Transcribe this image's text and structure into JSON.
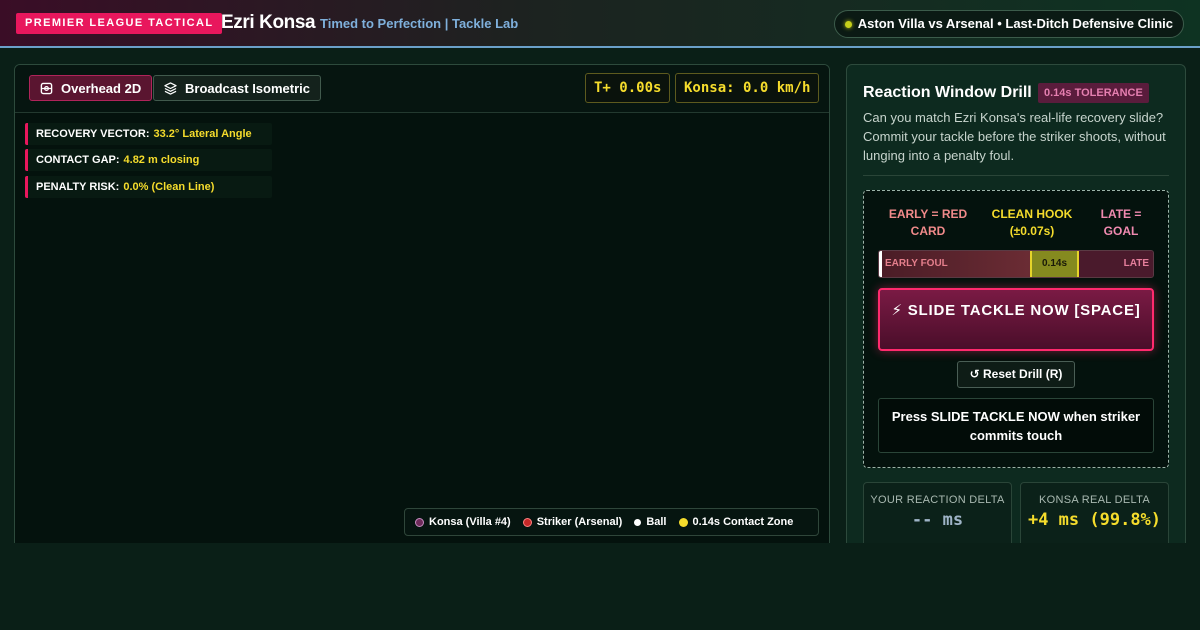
{
  "header": {
    "league_badge": "PREMIER LEAGUE TACTICAL",
    "player_name": "Ezri Konsa",
    "subtitle": "Timed to Perfection | Tackle Lab",
    "match_label": "Aston Villa vs Arsenal • Last-Ditch Defensive Clinic"
  },
  "pitch": {
    "views": [
      {
        "label": "Overhead 2D",
        "icon": "grid-target-icon",
        "active": true
      },
      {
        "label": "Broadcast Isometric",
        "icon": "layers-icon",
        "active": false
      }
    ],
    "timer": "T+ 0.00s",
    "speed": "Konsa: 0.0 km/h",
    "stats": [
      {
        "label": "RECOVERY VECTOR:",
        "value": "33.2° Lateral Angle"
      },
      {
        "label": "CONTACT GAP:",
        "value": "4.82 m closing"
      },
      {
        "label": "PENALTY RISK:",
        "value": "0.0% (Clean Line)"
      }
    ],
    "legend": [
      {
        "label": "Konsa (Villa #4)",
        "color": "#6e2a5a",
        "border": "#c58ec0"
      },
      {
        "label": "Striker (Arsenal)",
        "color": "#c62828",
        "border": "#ff8080"
      },
      {
        "label": "Ball",
        "color": "#ffffff",
        "border": "#ffffff"
      },
      {
        "label": "0.14s Contact Zone",
        "color": "#f5dc2c",
        "border": "#f5dc2c"
      }
    ]
  },
  "drill": {
    "title": "Reaction Window Drill",
    "tolerance_badge": "0.14s TOLERANCE",
    "description": "Can you match Ezri Konsa's real-life recovery slide? Commit your tackle before the striker shoots, without lunging into a penalty foul.",
    "zones": {
      "early": "EARLY = RED CARD",
      "clean": "CLEAN HOOK (±0.07s)",
      "late": "LATE = GOAL"
    },
    "bar": {
      "early_label": "EARLY FOUL",
      "clean_label": "0.14s",
      "late_label": "LATE"
    },
    "tackle_button": "⚡ SLIDE TACKLE NOW [SPACE]",
    "reset_button": "↺ Reset Drill (R)",
    "instruction": "Press SLIDE TACKLE NOW when striker commits touch",
    "stats": {
      "your_label": "YOUR REACTION DELTA",
      "your_value": "-- ms",
      "konsa_label": "KONSA REAL DELTA",
      "konsa_value": "+4 ms (99.8%)"
    }
  },
  "colors": {
    "accent_pink": "#e8175d",
    "highlight_yellow": "#f5dc2c",
    "panel_bg": "#04120d",
    "page_bg": "#0a1f17"
  }
}
